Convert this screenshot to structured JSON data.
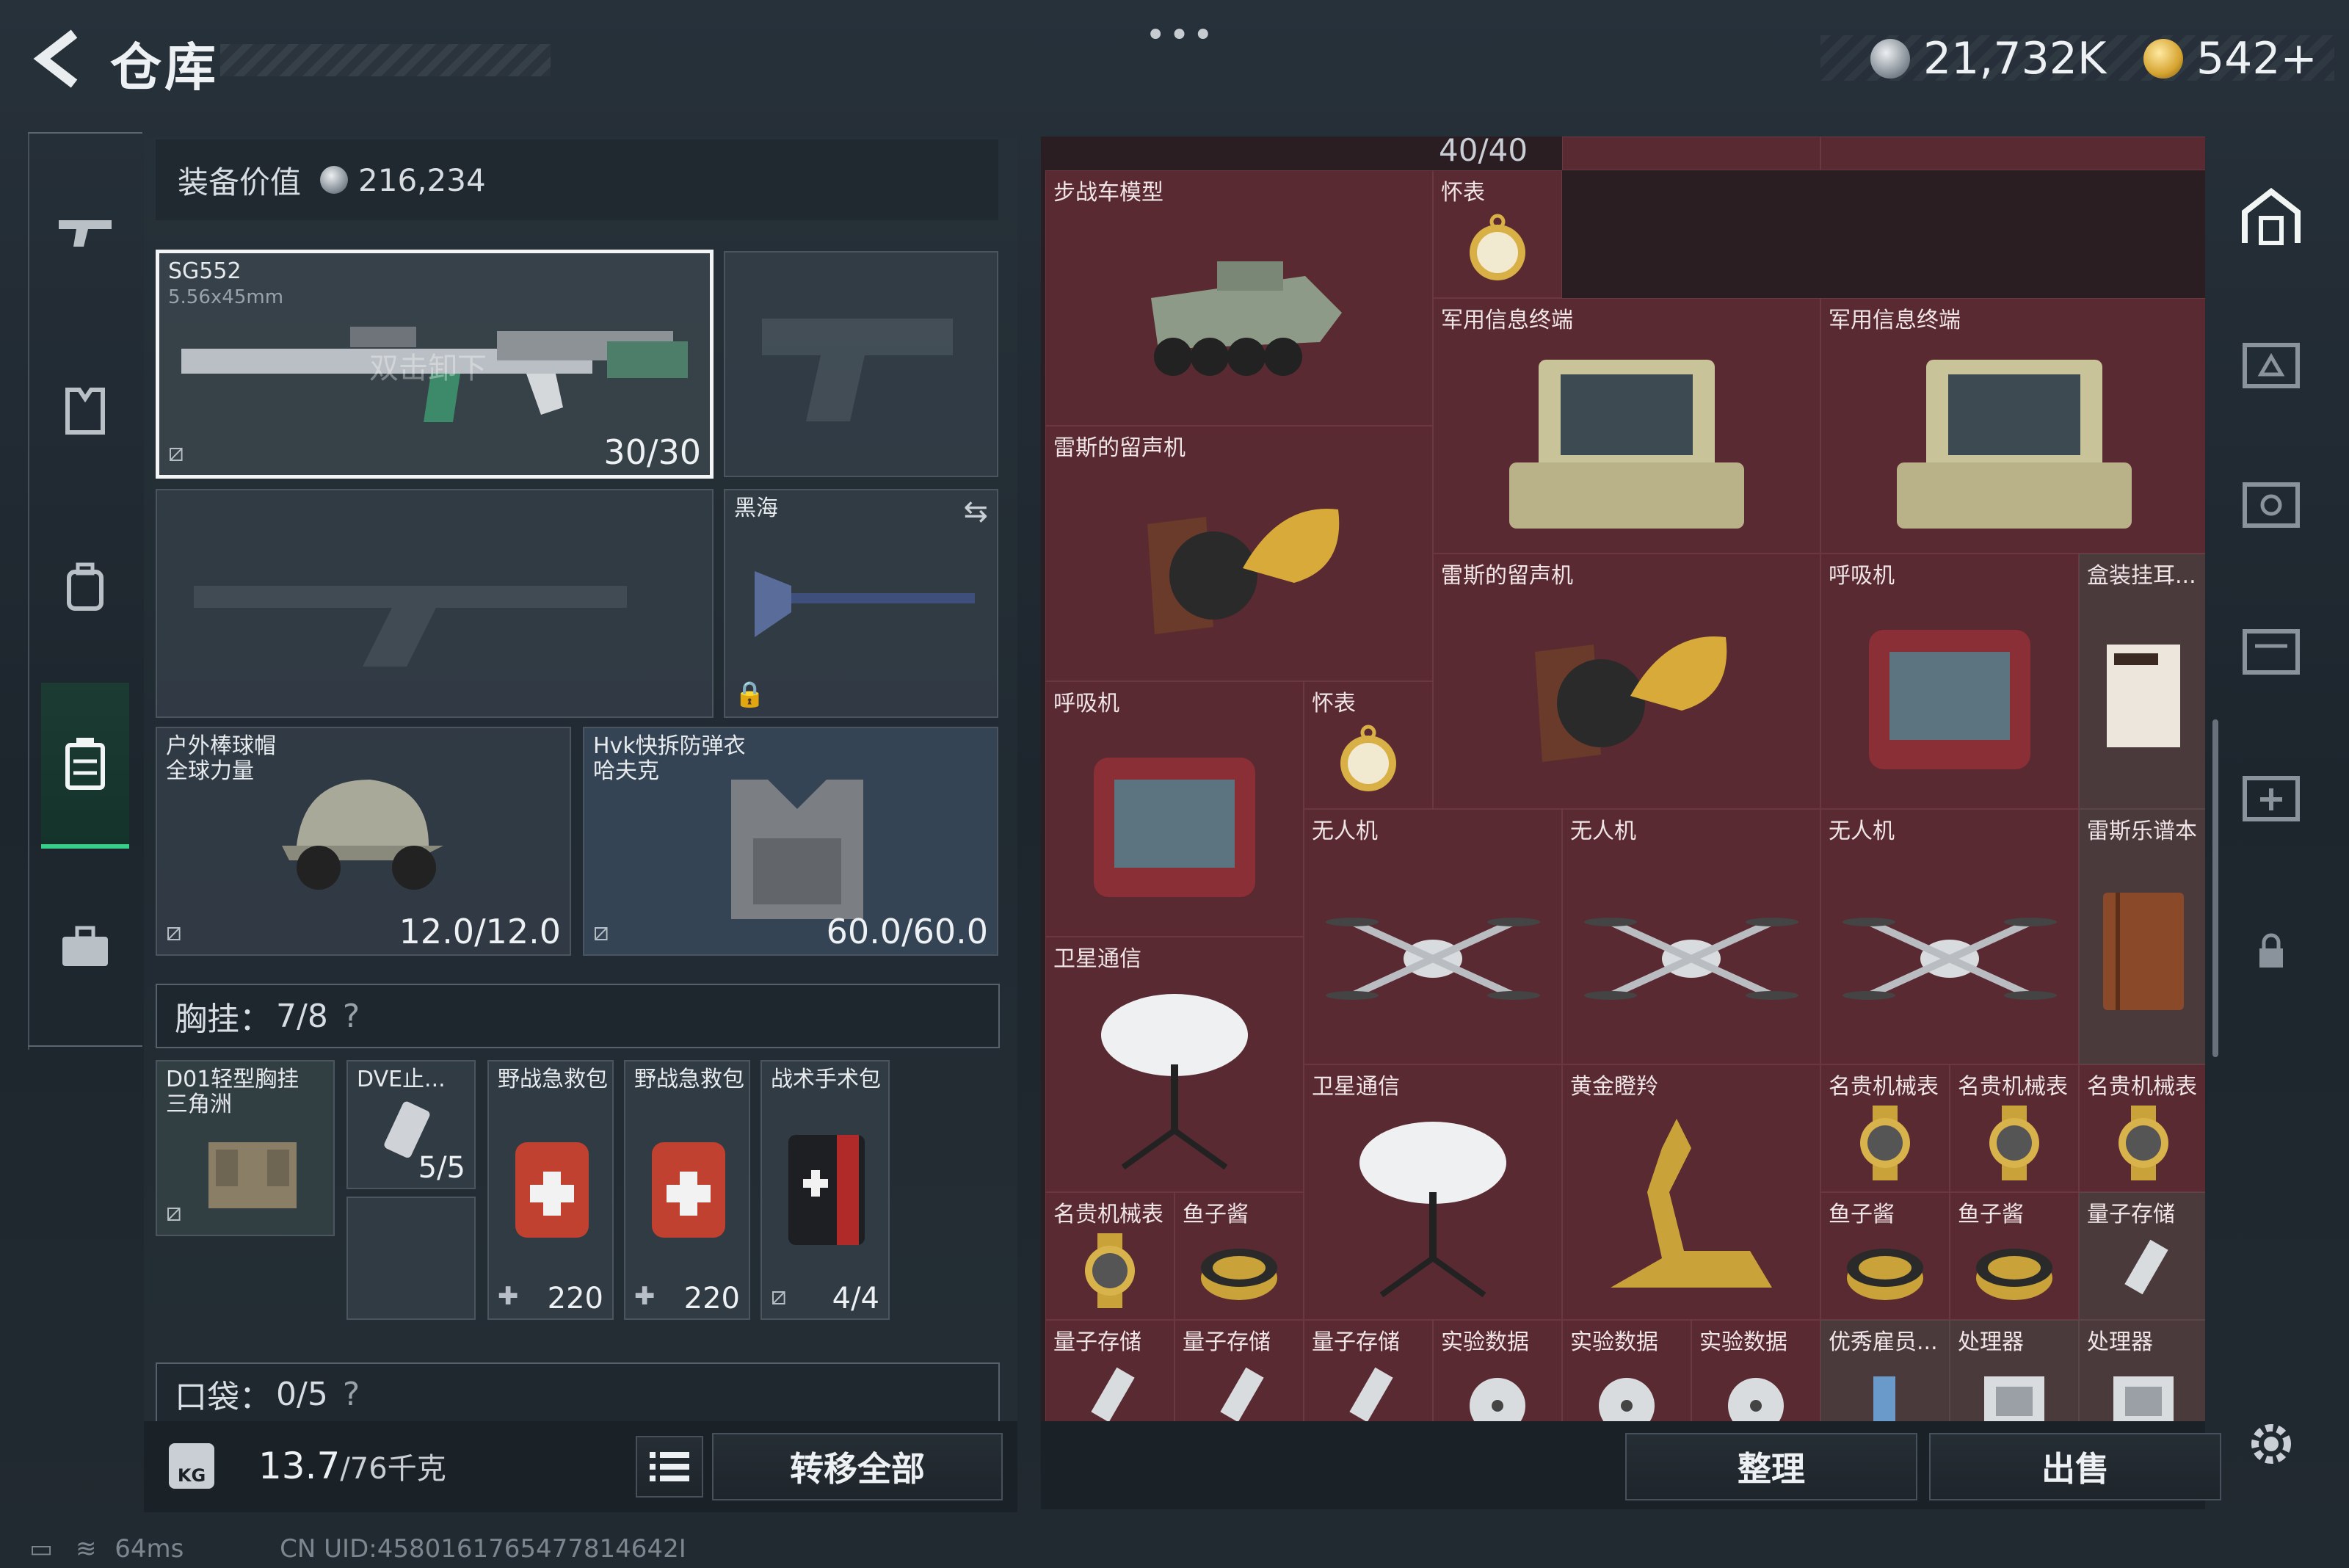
{
  "header": {
    "title": "仓库",
    "more_label": "•••"
  },
  "currency": {
    "silver": "21,732K",
    "gold": "542+"
  },
  "equipment": {
    "value_label": "装备价值",
    "value": "216,234",
    "primary_weapon": {
      "name": "SG552",
      "caliber": "5.56x45mm",
      "hint": "双击卸下",
      "ammo": "30/30"
    },
    "melee": {
      "name": "黑海"
    },
    "helmet": {
      "name": "户外棒球帽",
      "sub": "全球力量",
      "durability": "12.0/12.0"
    },
    "armor": {
      "name": "Hvk快拆防弹衣",
      "sub": "哈夫克",
      "durability": "60.0/60.0"
    },
    "chest_rig": {
      "label": "胸挂：",
      "count": "7/8",
      "help": "?"
    },
    "rig_items": [
      {
        "name": "D01轻型胸挂",
        "sub": "三角洲"
      },
      {
        "name": "DVE止...",
        "qty": "5/5"
      },
      {
        "name": "野战急救包",
        "qty": "220"
      },
      {
        "name": "野战急救包",
        "qty": "220"
      },
      {
        "name": "战术手术包",
        "qty": "4/4"
      }
    ],
    "pocket": {
      "label": "口袋：",
      "count": "0/5",
      "help": "?"
    },
    "weight": {
      "value": "13.7",
      "max": "/76千克",
      "icon_text": "KG"
    },
    "transfer_all": "转移全部"
  },
  "stash": {
    "capacity": "40/40",
    "sort_label": "整理",
    "sell_label": "出售",
    "items": [
      {
        "name": "步战车模型"
      },
      {
        "name": "怀表"
      },
      {
        "name": "军用信息终端"
      },
      {
        "name": "军用信息终端"
      },
      {
        "name": "雷斯的留声机"
      },
      {
        "name": "雷斯的留声机"
      },
      {
        "name": "呼吸机"
      },
      {
        "name": "盒装挂耳..."
      },
      {
        "name": "呼吸机"
      },
      {
        "name": "怀表"
      },
      {
        "name": "无人机"
      },
      {
        "name": "无人机"
      },
      {
        "name": "无人机"
      },
      {
        "name": "雷斯乐谱本"
      },
      {
        "name": "卫星通信"
      },
      {
        "name": "卫星通信"
      },
      {
        "name": "黄金瞪羚"
      },
      {
        "name": "名贵机械表"
      },
      {
        "name": "名贵机械表"
      },
      {
        "name": "名贵机械表"
      },
      {
        "name": "名贵机械表"
      },
      {
        "name": "鱼子酱"
      },
      {
        "name": "鱼子酱"
      },
      {
        "name": "鱼子酱"
      },
      {
        "name": "量子存储"
      },
      {
        "name": "量子存储"
      },
      {
        "name": "量子存储"
      },
      {
        "name": "量子存储"
      },
      {
        "name": "实验数据"
      },
      {
        "name": "实验数据"
      },
      {
        "name": "实验数据"
      },
      {
        "name": "优秀雇员..."
      },
      {
        "name": "处理器"
      },
      {
        "name": "处理器"
      }
    ]
  },
  "status_bar": {
    "ping": "64ms",
    "uid": "CN UID:4580161765477814642I"
  },
  "colors": {
    "accent": "#39d08a",
    "stash_cell": "#5a2a32",
    "panel": "#28323a"
  }
}
